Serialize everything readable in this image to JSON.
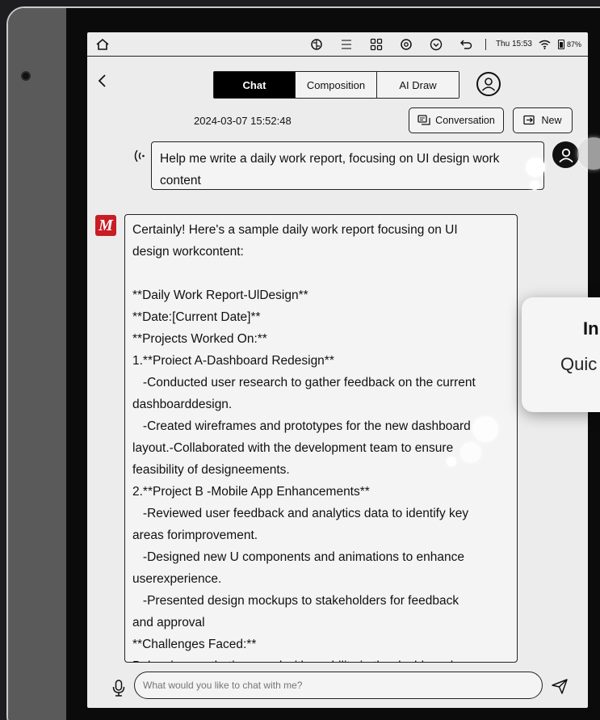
{
  "statusbar": {
    "time": "Thu 15:53",
    "battery": "87%",
    "icons": [
      "home-icon",
      "brain-icon",
      "list-icon",
      "apps-icon",
      "settings-icon",
      "chevron-circle-icon",
      "undo-icon",
      "wifi-icon"
    ]
  },
  "header": {
    "tabs": [
      {
        "label": "Chat",
        "active": true
      },
      {
        "label": "Composition",
        "active": false
      },
      {
        "label": "AI Draw",
        "active": false
      }
    ]
  },
  "session": {
    "datetime": "2024-03-07 15:52:48",
    "conversation_label": "Conversation",
    "new_label": "New"
  },
  "messages": {
    "user_lines": [
      "Help me write a daily work report, focusing on UI design work",
      "content"
    ],
    "ai_logo_letter": "M",
    "ai_lines": [
      "Certainly! Here's a sample daily work report focusing on UI",
      "design workcontent:",
      "",
      "**Daily Work Report-UlDesign**",
      "**Date:[Current Date]**",
      "**Projects Worked On:**",
      "1.**Proiect A-Dashboard Redesign**",
      "   -Conducted user research to gather feedback on the current",
      "dashboarddesign.",
      "   -Created wireframes and prototypes for the new dashboard",
      "layout.-Collaborated with the development team to ensure",
      "feasibility of designeements.",
      "2.**Project B -Mobile App Enhancements**",
      "   -Reviewed user feedback and analytics data to identify key",
      "areas forimprovement.",
      "   -Designed new U components and animations to enhance",
      "userexperience.",
      "   -Presented design mockups to stakeholders for feedback",
      "and approval",
      "**Challenges Faced:**",
      "Balancing aesthetic appeal with usability in the dashboard"
    ]
  },
  "input": {
    "placeholder": "What would you like to chat with me?"
  },
  "popup": {
    "title": "In",
    "subtitle": "Quic"
  }
}
